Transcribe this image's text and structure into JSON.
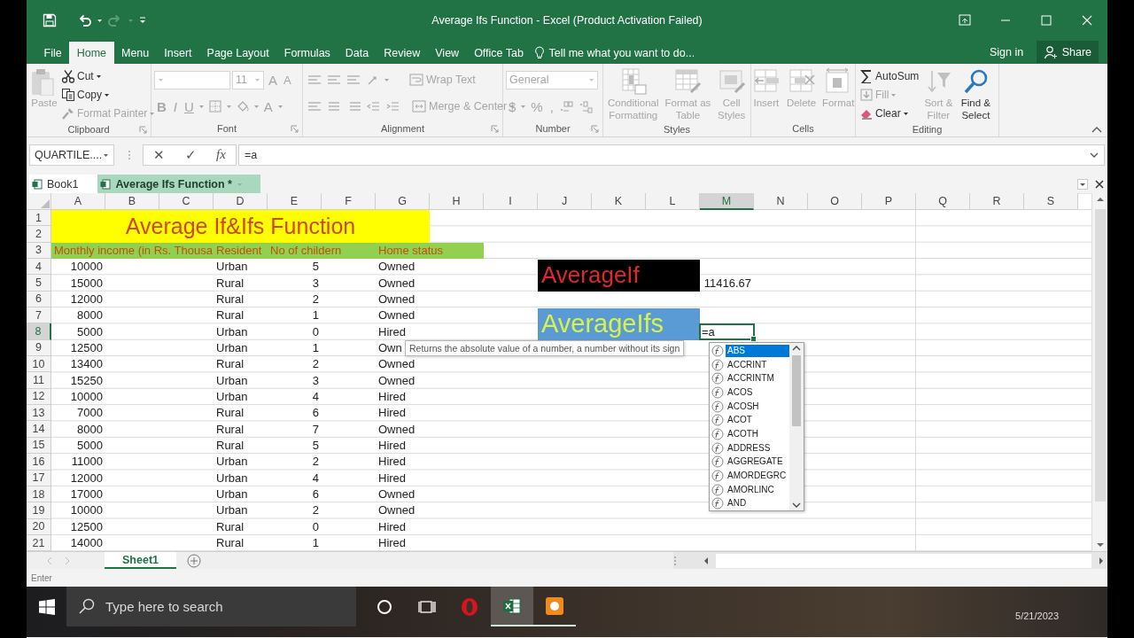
{
  "window": {
    "title": "Average Ifs Function - Excel (Product Activation Failed)"
  },
  "ribbon_tabs": [
    {
      "label": "File",
      "selected": false
    },
    {
      "label": "Home",
      "selected": true
    },
    {
      "label": "Menu",
      "selected": false
    },
    {
      "label": "Insert",
      "selected": false
    },
    {
      "label": "Page Layout",
      "selected": false
    },
    {
      "label": "Formulas",
      "selected": false
    },
    {
      "label": "Data",
      "selected": false
    },
    {
      "label": "Review",
      "selected": false
    },
    {
      "label": "View",
      "selected": false
    },
    {
      "label": "Office Tab",
      "selected": false
    }
  ],
  "tell_me": "Tell me what you want to do...",
  "account": {
    "sign_in": "Sign in",
    "share": "Share"
  },
  "ribbon_groups": [
    {
      "kind": "clipboard",
      "name": "Clipboard",
      "commands": [
        {
          "label": "Paste",
          "disabled": true
        },
        {
          "label": "Cut",
          "disabled": false
        },
        {
          "label": "Copy",
          "disabled": false
        },
        {
          "label": "Format Painter",
          "disabled": true
        }
      ]
    },
    {
      "kind": "font",
      "name": "Font",
      "disabled": true,
      "size": "11",
      "grow": "A",
      "shrink": "A",
      "styles": [
        "B",
        "I",
        "U"
      ],
      "color_button": "A"
    },
    {
      "kind": "alignment",
      "name": "Alignment",
      "disabled": true,
      "commands": [
        {
          "label": "Wrap Text"
        },
        {
          "label": "Merge & Center"
        }
      ]
    },
    {
      "kind": "number",
      "name": "Number",
      "disabled": true,
      "format": "General",
      "symbols": [
        "$",
        "%",
        ","
      ]
    },
    {
      "kind": "large",
      "name": "Styles",
      "commands": [
        {
          "label": "Conditional Formatting",
          "disabled": true
        },
        {
          "label": "Format as Table",
          "disabled": true
        },
        {
          "label": "Cell Styles",
          "disabled": true
        }
      ]
    },
    {
      "kind": "large",
      "name": "Cells",
      "commands": [
        {
          "label": "Insert",
          "disabled": true
        },
        {
          "label": "Delete",
          "disabled": true
        },
        {
          "label": "Format",
          "disabled": true
        }
      ]
    },
    {
      "kind": "editing",
      "name": "Editing",
      "commands": [
        {
          "label": "AutoSum",
          "disabled": false
        },
        {
          "label": "Fill",
          "disabled": true
        },
        {
          "label": "Clear",
          "disabled": false
        },
        {
          "label": "Sort & Filter",
          "disabled": true
        },
        {
          "label": "Find & Select",
          "disabled": false
        }
      ]
    }
  ],
  "formula_bar": {
    "name_box": "QUARTILE....",
    "cancel": "✕",
    "enter": "✓",
    "insert_function": "fx",
    "formula": "=a"
  },
  "workbook_tabs": [
    {
      "label": "Book1",
      "selected": false
    },
    {
      "label": "Average Ifs Function *",
      "selected": true
    }
  ],
  "sheet": {
    "columns": [
      {
        "label": "A",
        "kind": "number",
        "active": false
      },
      {
        "label": "B",
        "active": false
      },
      {
        "label": "C",
        "active": false
      },
      {
        "label": "D",
        "active": false
      },
      {
        "label": "E",
        "kind": "number",
        "active": false
      },
      {
        "label": "F",
        "active": false
      },
      {
        "label": "G",
        "active": false
      },
      {
        "label": "H",
        "active": false
      },
      {
        "label": "I",
        "active": false
      },
      {
        "label": "J",
        "active": false
      },
      {
        "label": "K",
        "active": false
      },
      {
        "label": "L",
        "active": false
      },
      {
        "label": "M",
        "kind": "number",
        "active": true
      },
      {
        "label": "N",
        "active": false
      },
      {
        "label": "O",
        "active": false
      },
      {
        "label": "P",
        "active": false
      },
      {
        "label": "Q",
        "active": false
      },
      {
        "label": "R",
        "active": false
      },
      {
        "label": "S",
        "active": false
      }
    ],
    "title_banner": "Average If&Ifs Function",
    "blocks": [
      {
        "kind": "dark",
        "text": "AverageIf"
      },
      {
        "kind": "blue",
        "text": "AverageIfs"
      }
    ],
    "rows": [
      {
        "number": "1"
      },
      {
        "number": "2"
      },
      {
        "number": "3",
        "kind": "header",
        "A": "Monthly income (in Rs. Thousa",
        "D": "Resident",
        "E": "No of childern",
        "G": "Home status"
      },
      {
        "number": "4",
        "A": "10000",
        "D": "Urban",
        "E": "5",
        "G": "Owned"
      },
      {
        "number": "5",
        "A": "15000",
        "D": "Rural",
        "E": "3",
        "G": "Owned",
        "M": "11416.67"
      },
      {
        "number": "6",
        "A": "12000",
        "D": "Rural",
        "E": "2",
        "G": "Owned"
      },
      {
        "number": "7",
        "A": "8000",
        "D": "Rural",
        "E": "1",
        "G": "Owned"
      },
      {
        "number": "8",
        "A": "5000",
        "D": "Urban",
        "E": "0",
        "G": "Hired",
        "M": "=a",
        "active": true
      },
      {
        "number": "9",
        "A": "12500",
        "D": "Urban",
        "E": "1",
        "G": "Own"
      },
      {
        "number": "10",
        "A": "13400",
        "D": "Rural",
        "E": "2",
        "G": "Owned"
      },
      {
        "number": "11",
        "A": "15250",
        "D": "Urban",
        "E": "3",
        "G": "Owned"
      },
      {
        "number": "12",
        "A": "10000",
        "D": "Urban",
        "E": "4",
        "G": "Hired"
      },
      {
        "number": "13",
        "A": "7000",
        "D": "Rural",
        "E": "6",
        "G": "Hired"
      },
      {
        "number": "14",
        "A": "8000",
        "D": "Rural",
        "E": "7",
        "G": "Owned"
      },
      {
        "number": "15",
        "A": "5000",
        "D": "Rural",
        "E": "5",
        "G": "Hired"
      },
      {
        "number": "16",
        "A": "11000",
        "D": "Urban",
        "E": "2",
        "G": "Hired"
      },
      {
        "number": "17",
        "A": "12000",
        "D": "Urban",
        "E": "4",
        "G": "Hired"
      },
      {
        "number": "18",
        "A": "17000",
        "D": "Urban",
        "E": "6",
        "G": "Owned"
      },
      {
        "number": "19",
        "A": "10000",
        "D": "Urban",
        "E": "2",
        "G": "Owned"
      },
      {
        "number": "20",
        "A": "12500",
        "D": "Rural",
        "E": "0",
        "G": "Hired"
      },
      {
        "number": "21",
        "A": "14000",
        "D": "Rural",
        "E": "1",
        "G": "Hired"
      }
    ],
    "tooltip": "Returns the absolute value of a number, a number without its sign",
    "autocomplete": [
      {
        "label": "ABS",
        "selected": true
      },
      {
        "label": "ACCRINT",
        "selected": false
      },
      {
        "label": "ACCRINTM",
        "selected": false
      },
      {
        "label": "ACOS",
        "selected": false
      },
      {
        "label": "ACOSH",
        "selected": false
      },
      {
        "label": "ACOT",
        "selected": false
      },
      {
        "label": "ACOTH",
        "selected": false
      },
      {
        "label": "ADDRESS",
        "selected": false
      },
      {
        "label": "AGGREGATE",
        "selected": false
      },
      {
        "label": "AMORDEGRC",
        "selected": false
      },
      {
        "label": "AMORLINC",
        "selected": false
      },
      {
        "label": "AND",
        "selected": false
      }
    ]
  },
  "sheet_tabs": [
    {
      "label": "Sheet1",
      "selected": true
    }
  ],
  "status_bar": {
    "mode": "Enter"
  },
  "taskbar": {
    "search_placeholder": "Type here to search",
    "date": "5/21/2023"
  }
}
